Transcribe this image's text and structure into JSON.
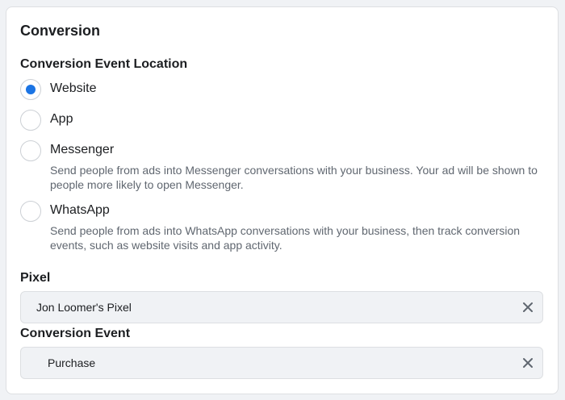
{
  "conversion": {
    "title": "Conversion",
    "location_label": "Conversion Event Location",
    "options": [
      {
        "label": "Website",
        "selected": true,
        "description": ""
      },
      {
        "label": "App",
        "selected": false,
        "description": ""
      },
      {
        "label": "Messenger",
        "selected": false,
        "description": "Send people from ads into Messenger conversations with your business. Your ad will be shown to people more likely to open Messenger."
      },
      {
        "label": "WhatsApp",
        "selected": false,
        "description": "Send people from ads into WhatsApp conversations with your business, then track conversion events, such as website visits and app activity."
      }
    ],
    "pixel_label": "Pixel",
    "pixel_value": "Jon Loomer's Pixel",
    "event_label": "Conversion Event",
    "event_value": "Purchase"
  },
  "icons": {
    "radio_selected": "radio-selected-icon",
    "radio_unselected": "radio-unselected-icon",
    "clear": "close-icon"
  },
  "colors": {
    "accent": "#1b74e4",
    "card_background": "#ffffff",
    "page_background": "#f0f2f5",
    "field_background": "#f0f2f5",
    "description_text": "#606770"
  }
}
